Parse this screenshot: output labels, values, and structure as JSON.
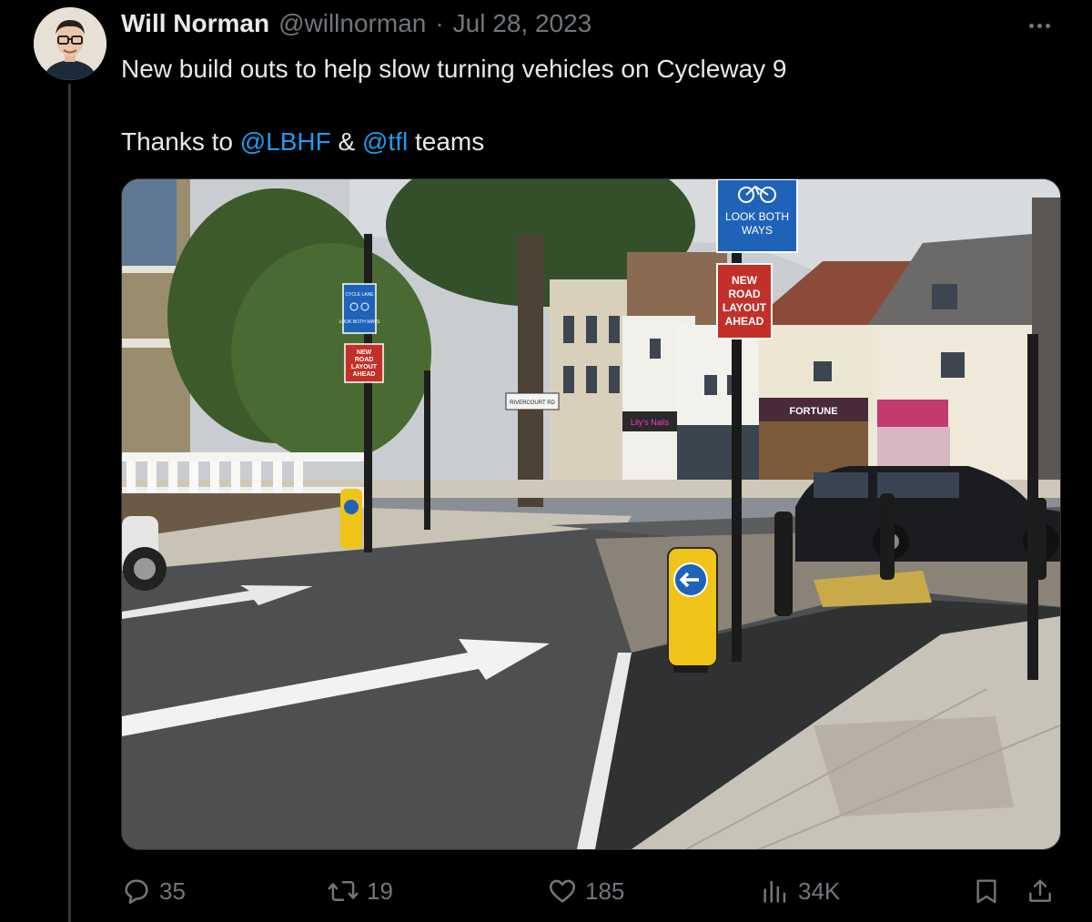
{
  "tweet": {
    "author_name": "Will Norman",
    "handle": "@willnorman",
    "separator": "·",
    "date": "Jul 28, 2023",
    "text_line1": "New build outs to help slow turning vehicles on Cycleway 9",
    "thanks_prefix": "Thanks to",
    "mention1": "@LBHF",
    "ampersand": "&",
    "mention2": "@tfl",
    "thanks_suffix": "teams"
  },
  "photo": {
    "sign_cycle_lane": "CYCLE LANE",
    "sign_look_both_small": "LOOK BOTH WAYS",
    "sign_new_layout_small": [
      "NEW",
      "ROAD",
      "LAYOUT",
      "AHEAD"
    ],
    "sign_look_both_big": [
      "LOOK BOTH",
      "WAYS"
    ],
    "sign_new_layout_big": [
      "NEW",
      "ROAD",
      "LAYOUT",
      "AHEAD"
    ],
    "street_sign": "RIVERCOURT RD",
    "shop_fortune": "FORTUNE",
    "shop_nails": "Lily's Nails"
  },
  "actions": {
    "replies": "35",
    "reposts": "19",
    "likes": "185",
    "views": "34K"
  },
  "icons": {
    "reply": "reply-icon",
    "repost": "repost-icon",
    "like": "heart-icon",
    "views": "views-icon",
    "bookmark": "bookmark-icon",
    "share": "share-icon",
    "more": "more-icon"
  },
  "colors": {
    "background": "#000000",
    "text": "#e7e9ea",
    "muted": "#71767b",
    "link": "#1d9bf0"
  }
}
